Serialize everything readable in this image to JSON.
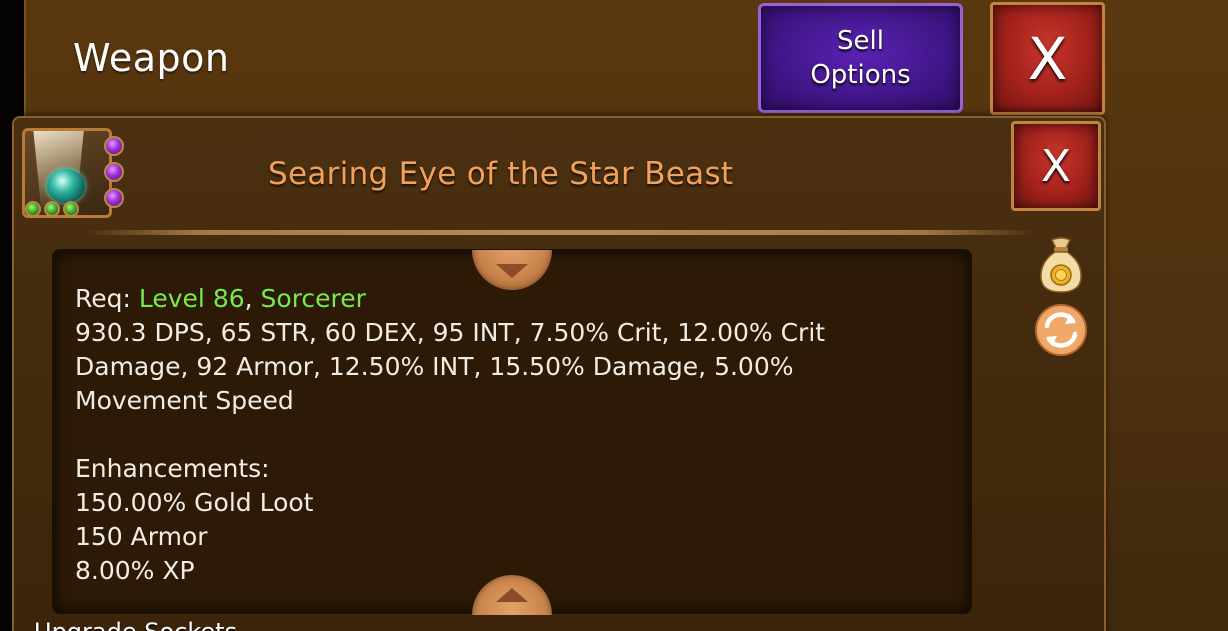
{
  "header": {
    "title": "Weapon",
    "sell_line1": "Sell",
    "sell_line2": "Options",
    "close_label": "X"
  },
  "item": {
    "name": "Searing Eye of the Star Beast",
    "close_label": "X",
    "purple_gems": 3,
    "green_gems": 3
  },
  "description": {
    "req_prefix": "Req: ",
    "req_level": "Level 86",
    "req_sep": ", ",
    "req_class": "Sorcerer",
    "stats_line1": "930.3 DPS, 65 STR, 60 DEX, 95 INT, 7.50% Crit, 12.00% Crit",
    "stats_line2": "Damage, 92 Armor, 12.50% INT, 15.50% Damage, 5.00%",
    "stats_line3": "Movement Speed",
    "enh_heading": "Enhancements:",
    "enhancements": [
      "150.00% Gold Loot",
      "150 Armor",
      "8.00% XP"
    ]
  },
  "footer": {
    "cutoff_text": "Upgrade Sockets"
  },
  "icons": {
    "gold_bag": "gold-bag-icon",
    "swap": "swap-icon",
    "scroll_up": "arrow-up-icon",
    "scroll_down": "arrow-down-icon"
  },
  "colors": {
    "panel": "#4d3110",
    "item_name": "#f2a05a",
    "requirement_green": "#78ea4d",
    "sell_button": "#401688",
    "close_button": "#a1221b"
  }
}
